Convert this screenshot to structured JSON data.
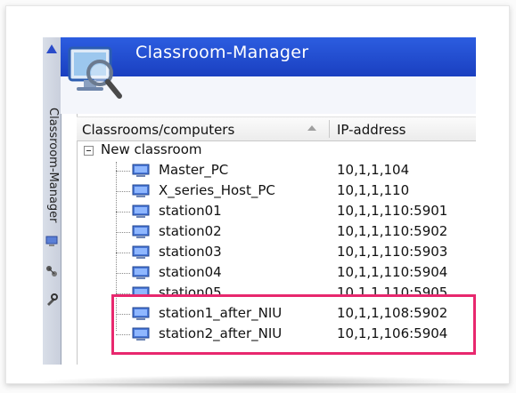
{
  "app": {
    "title": "Classroom-Manager",
    "sidebar_label": "Classroom-Manager"
  },
  "table": {
    "columns": [
      "Classrooms/computers",
      "IP-address"
    ],
    "group": "New classroom",
    "rows": [
      {
        "name": "Master_PC",
        "ip": "10,1,1,104"
      },
      {
        "name": "X_series_Host_PC",
        "ip": "10,1,1,110"
      },
      {
        "name": "station01",
        "ip": "10,1,1,110:5901"
      },
      {
        "name": "station02",
        "ip": "10,1,1,110:5902"
      },
      {
        "name": "station03",
        "ip": "10,1,1,110:5903"
      },
      {
        "name": "station04",
        "ip": "10,1,1,110:5904"
      },
      {
        "name": "station05",
        "ip": "10,1,1,110:5905"
      },
      {
        "name": "station1_after_NIU",
        "ip": "10,1,1,108:5902"
      },
      {
        "name": "station2_after_NIU",
        "ip": "10,1,1,106:5904"
      }
    ]
  },
  "colors": {
    "banner": "#1a3fc0",
    "highlight": "#e8286e"
  }
}
